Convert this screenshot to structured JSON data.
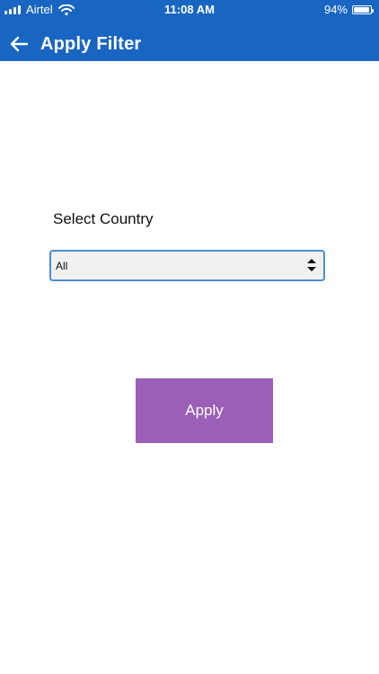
{
  "status_bar": {
    "carrier": "Airtel",
    "time": "11:08 AM",
    "battery": "94%",
    "battery_level": 0.94,
    "icons": [
      "signal-icon",
      "wifi-icon",
      "battery-icon"
    ]
  },
  "header": {
    "title": "Apply Filter",
    "back_icon": "back-arrow-icon",
    "background_color": "#1966c2"
  },
  "form": {
    "country_label": "Select Country",
    "country_value": "All",
    "select_icon": "updown-arrows-icon"
  },
  "actions": {
    "apply_label": "Apply",
    "apply_color": "#9b5fb7"
  }
}
